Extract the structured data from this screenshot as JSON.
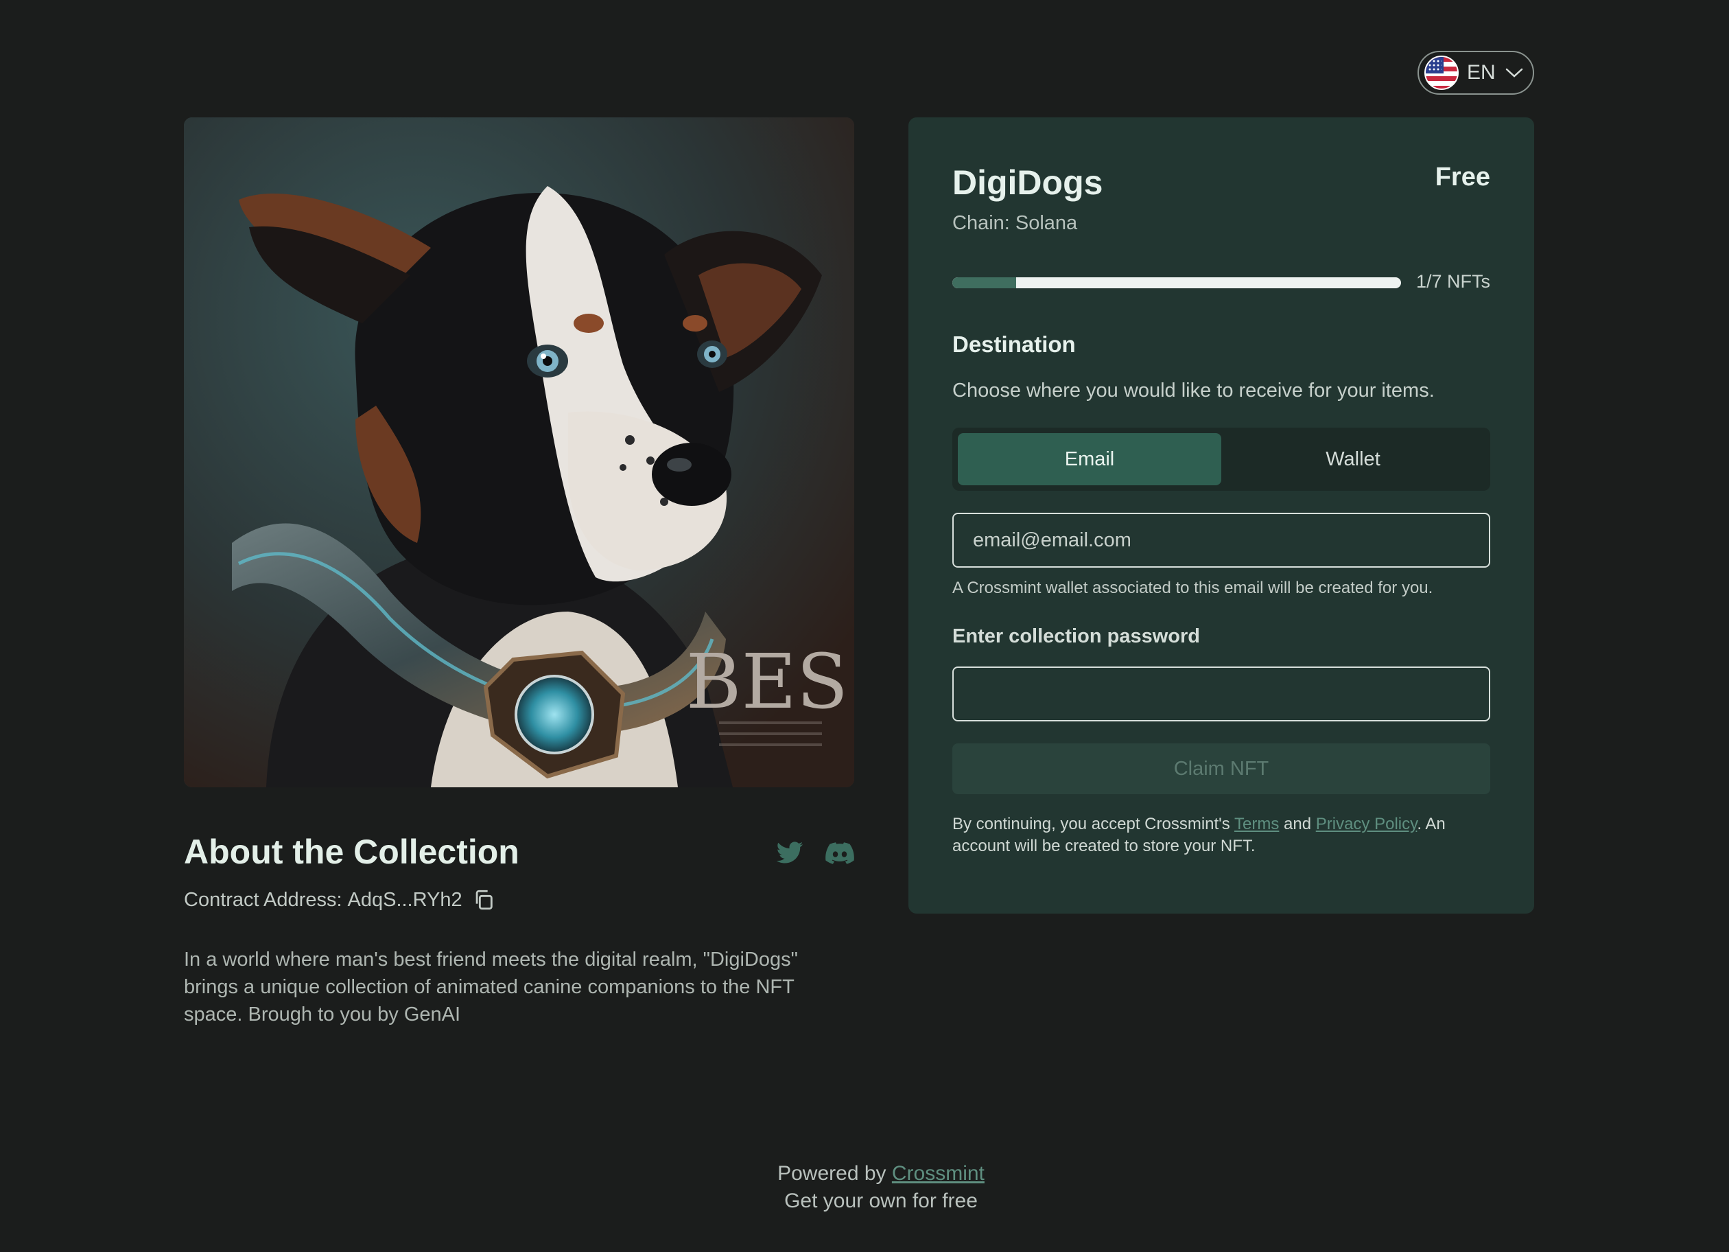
{
  "language": {
    "label": "EN"
  },
  "collection": {
    "about_title": "About the Collection",
    "contract_label": "Contract Address:",
    "contract_address": "AdqS...RYh2",
    "description": "In a world where man's best friend meets the digital realm, \"DigiDogs\" brings a unique collection of animated canine companions to the NFT space. Brough to you by GenAI",
    "artwork_watermark": "BES"
  },
  "card": {
    "title": "DigiDogs",
    "price": "Free",
    "chain": "Chain: Solana",
    "progress": {
      "minted": 1,
      "total": 7,
      "label": "1/7 NFTs"
    },
    "destination_title": "Destination",
    "destination_desc": "Choose where you would like to receive for your items.",
    "tabs": {
      "email": "Email",
      "wallet": "Wallet"
    },
    "email_placeholder": "email@email.com",
    "email_note": "A Crossmint wallet associated to this email will be created for you.",
    "password_label": "Enter collection password",
    "claim_button": "Claim NFT",
    "terms": {
      "prefix": "By continuing, you accept Crossmint's",
      "terms_link": "Terms",
      "and": "and",
      "privacy_link": "Privacy Policy",
      "suffix": ". An account will be created to store your NFT."
    }
  },
  "footer": {
    "powered_by": "Powered by",
    "brand_link": "Crossmint",
    "tagline": "Get your own for free"
  },
  "colors": {
    "background": "#1b1d1c",
    "card": "#223631",
    "accent": "#2f5f51",
    "link": "#5f8f80"
  }
}
